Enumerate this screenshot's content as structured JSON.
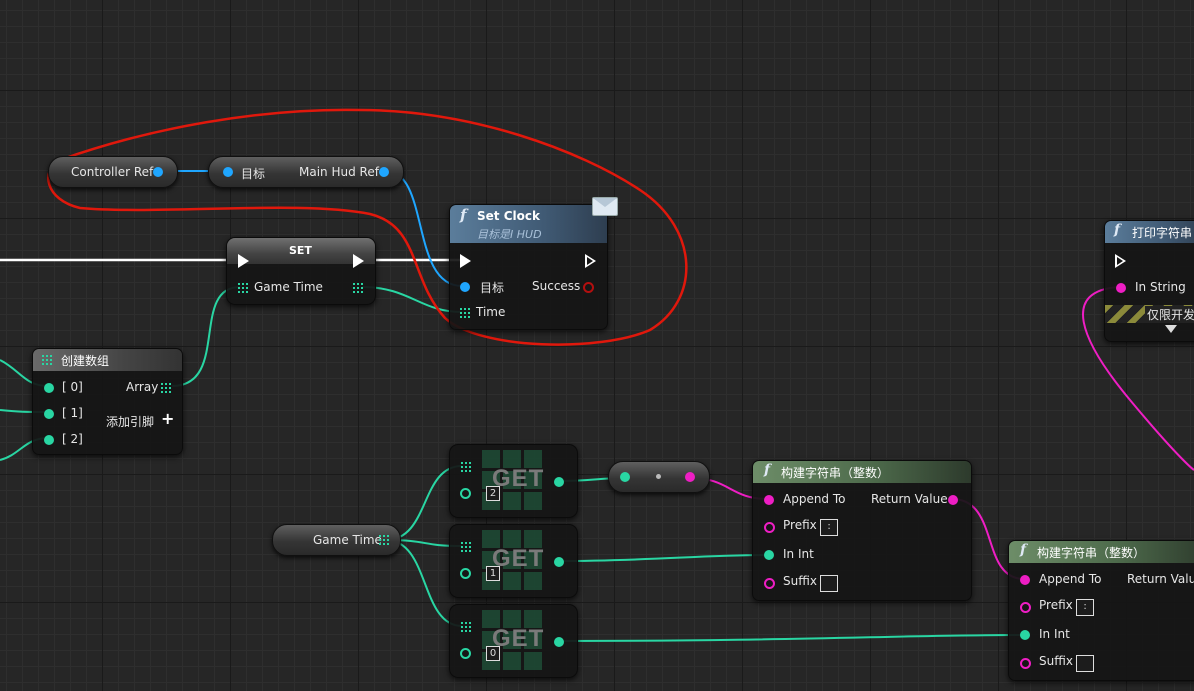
{
  "variables": {
    "controller_ref": "Controller Ref",
    "main_hud_target": "目标",
    "main_hud_ref": "Main Hud Ref",
    "game_time": "Game Time"
  },
  "set_clock": {
    "title": "Set Clock",
    "subtitle": "目标是I HUD",
    "target": "目标",
    "success": "Success",
    "time": "Time"
  },
  "set_node": {
    "title": "SET",
    "game_time": "Game Time"
  },
  "make_array": {
    "title": "创建数组",
    "pins": [
      "[ 0]",
      "[ 1]",
      "[ 2]"
    ],
    "array": "Array",
    "add_pin": "添加引脚"
  },
  "get_nodes": [
    {
      "label": "GET",
      "index": "2"
    },
    {
      "label": "GET",
      "index": "1"
    },
    {
      "label": "GET",
      "index": "0"
    }
  ],
  "build_string_1": {
    "title": "构建字符串（整数）",
    "append_to": "Append To",
    "return_value": "Return Value",
    "prefix": "Prefix",
    "prefix_value": ":",
    "in_int": "In Int",
    "suffix": "Suffix"
  },
  "build_string_2": {
    "title": "构建字符串（整数）",
    "append_to": "Append To",
    "return_value": "Return Value",
    "prefix": "Prefix",
    "prefix_value": ":",
    "in_int": "In Int",
    "suffix": "Suffix"
  },
  "print_string": {
    "title": "打印字符串",
    "in_string": "In String",
    "dev_only": "仅限开发"
  },
  "colors": {
    "exec": "#ffffff",
    "object": "#1fa6ff",
    "integer": "#29d6a3",
    "string": "#ee1ec4",
    "annotation": "#e0180c"
  }
}
